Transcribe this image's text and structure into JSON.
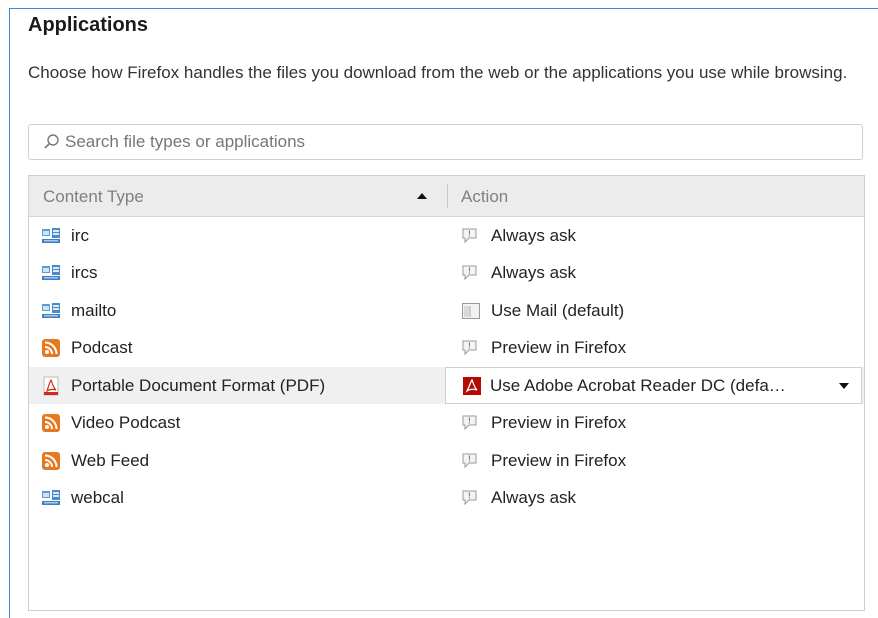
{
  "section": {
    "title": "Applications",
    "description": "Choose how Firefox handles the files you download from the web or the applications you use while browsing."
  },
  "search": {
    "placeholder": "Search file types or applications",
    "value": ""
  },
  "table": {
    "headers": {
      "content_type": "Content Type",
      "action": "Action"
    },
    "sort_column": "content_type",
    "sort_direction": "ascending",
    "rows": [
      {
        "content_type": "irc",
        "content_icon": "app-window-icon",
        "action": "Always ask",
        "action_icon": "ask-icon"
      },
      {
        "content_type": "ircs",
        "content_icon": "app-window-icon",
        "action": "Always ask",
        "action_icon": "ask-icon"
      },
      {
        "content_type": "mailto",
        "content_icon": "app-window-icon",
        "action": "Use Mail (default)",
        "action_icon": "mail-app-icon"
      },
      {
        "content_type": "Podcast",
        "content_icon": "rss-feed-icon",
        "action": "Preview in Firefox",
        "action_icon": "preview-icon"
      },
      {
        "content_type": "Portable Document Format (PDF)",
        "content_icon": "pdf-file-icon",
        "action": "Use Adobe Acrobat Reader DC  (defa…",
        "action_icon": "acrobat-icon",
        "selected": true
      },
      {
        "content_type": "Video Podcast",
        "content_icon": "rss-feed-icon",
        "action": "Preview in Firefox",
        "action_icon": "preview-icon"
      },
      {
        "content_type": "Web Feed",
        "content_icon": "rss-feed-icon",
        "action": "Preview in Firefox",
        "action_icon": "preview-icon"
      },
      {
        "content_type": "webcal",
        "content_icon": "app-window-icon",
        "action": "Always ask",
        "action_icon": "ask-icon"
      }
    ]
  },
  "colors": {
    "frame_border": "#3c8ad6",
    "header_bg": "#ececec",
    "rss_orange": "#e8781e",
    "acrobat_red": "#b30b00"
  }
}
